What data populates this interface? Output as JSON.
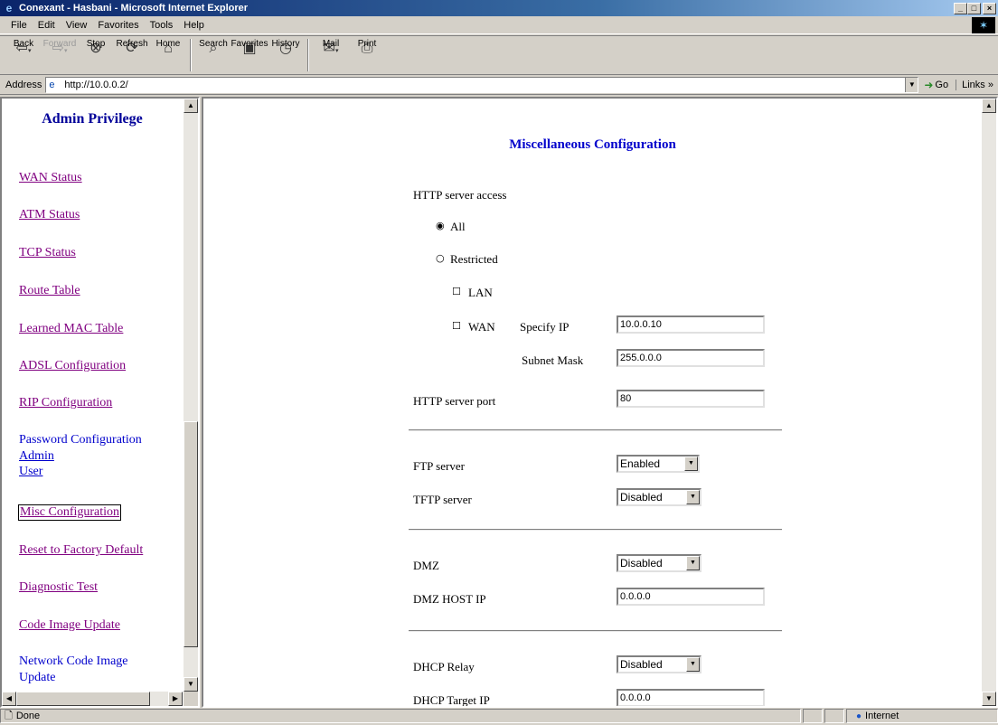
{
  "window": {
    "title": "Conexant - Hasbani - Microsoft Internet Explorer",
    "buttons": {
      "minimize": "_",
      "maximize": "□",
      "close": "×"
    }
  },
  "menu": [
    "File",
    "Edit",
    "View",
    "Favorites",
    "Tools",
    "Help"
  ],
  "toolbar": {
    "back": "Back",
    "forward": "Forward",
    "stop": "Stop",
    "refresh": "Refresh",
    "home": "Home",
    "search": "Search",
    "favorites": "Favorites",
    "history": "History",
    "mail": "Mail",
    "print": "Print"
  },
  "address": {
    "label": "Address",
    "url": "http://10.0.0.2/",
    "go": "Go",
    "links": "Links »"
  },
  "sidebar": {
    "title": "Admin Privilege",
    "items": [
      {
        "label": "WAN Status"
      },
      {
        "label": "ATM Status"
      },
      {
        "label": "TCP Status"
      },
      {
        "label": "Route Table"
      },
      {
        "label": "Learned MAC Table"
      },
      {
        "label": "ADSL Configuration"
      },
      {
        "label": "RIP Configuration"
      },
      {
        "label": "Password Configuration"
      },
      {
        "label": "Admin"
      },
      {
        "label": "User"
      },
      {
        "label": "Misc Configuration"
      },
      {
        "label": "Reset to Factory Default"
      },
      {
        "label": "Diagnostic Test"
      },
      {
        "label": "Code Image Update"
      },
      {
        "label": "Network Code Image"
      },
      {
        "label": "Update"
      }
    ]
  },
  "main": {
    "title": "Miscellaneous Configuration",
    "http_access": {
      "label": "HTTP server access",
      "options": [
        {
          "label": "All",
          "checked": true
        },
        {
          "label": "Restricted",
          "checked": false
        }
      ],
      "lan": {
        "label": "LAN",
        "checked": false
      },
      "wan": {
        "label": "WAN",
        "checked": false
      },
      "specify_ip_label": "Specify IP",
      "specify_ip_value": "10.0.0.10",
      "subnet_mask_label": "Subnet Mask",
      "subnet_mask_value": "255.0.0.0"
    },
    "http_port": {
      "label": "HTTP server port",
      "value": "80"
    },
    "ftp": {
      "label": "FTP server",
      "value": "Enabled"
    },
    "tftp": {
      "label": "TFTP server",
      "value": "Disabled"
    },
    "dmz": {
      "label": "DMZ",
      "value": "Disabled"
    },
    "dmz_host": {
      "label": "DMZ HOST IP",
      "value": "0.0.0.0"
    },
    "dhcp_relay": {
      "label": "DHCP Relay",
      "value": "Disabled"
    },
    "dhcp_target": {
      "label": "DHCP Target IP",
      "value": "0.0.0.0"
    }
  },
  "status": {
    "text": "Done",
    "zone": "Internet"
  }
}
